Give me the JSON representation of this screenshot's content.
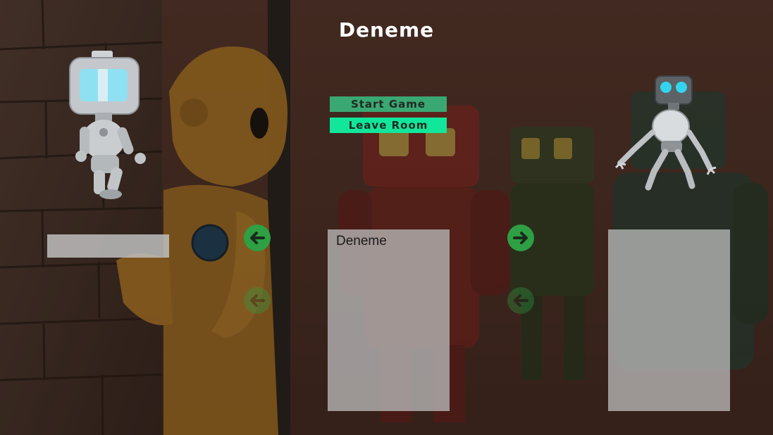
{
  "room": {
    "title": "Deneme"
  },
  "buttons": {
    "start_game": "Start Game",
    "leave_room": "Leave Room"
  },
  "players": {
    "slot_left_name": "",
    "slot_center_name": "Deneme",
    "slot_right_name": ""
  },
  "icons": {
    "prev": "arrow-left-icon",
    "next": "arrow-right-icon"
  },
  "colors": {
    "start_button": "#3aa873",
    "leave_button": "#11e69a",
    "arrow_active": "#2ea043",
    "title": "#ffffff"
  }
}
